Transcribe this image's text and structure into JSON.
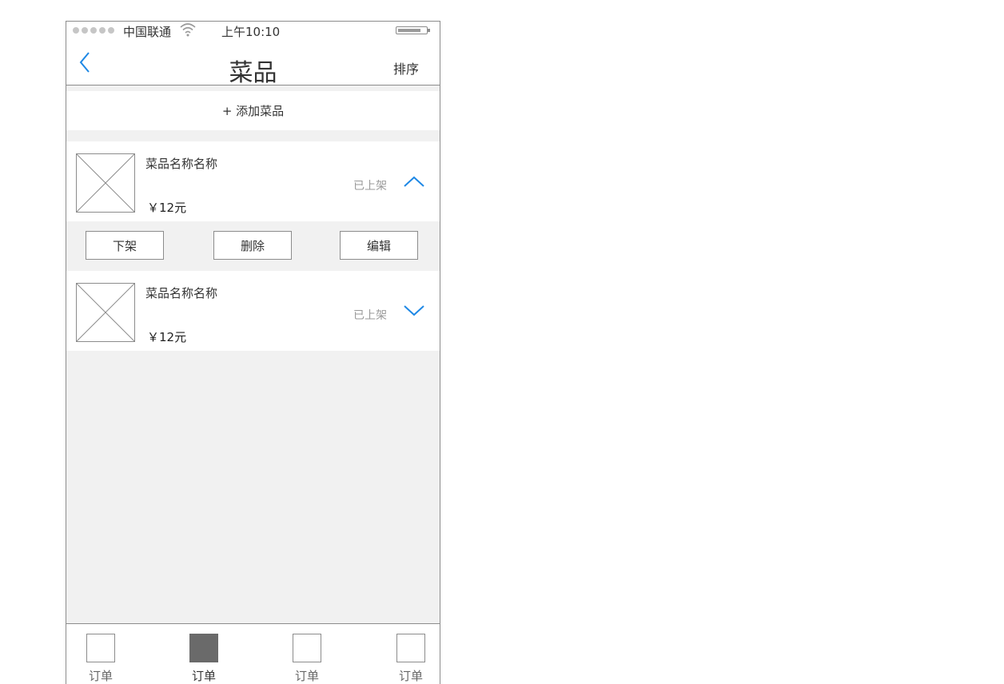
{
  "status_bar": {
    "carrier": "中国联通",
    "time": "上午10:10"
  },
  "nav": {
    "title": "菜品",
    "sort_label": "排序"
  },
  "add_dish_label": "+ 添加菜品",
  "dishes": [
    {
      "name": "菜品名称名称",
      "price": "￥12元",
      "status": "已上架",
      "expanded": true
    },
    {
      "name": "菜品名称名称",
      "price": "￥12元",
      "status": "已上架",
      "expanded": false
    }
  ],
  "actions": {
    "unlist": "下架",
    "delete": "删除",
    "edit": "编辑"
  },
  "tabs": [
    {
      "label": "订单",
      "active": false
    },
    {
      "label": "订单",
      "active": true
    },
    {
      "label": "订单",
      "active": false
    },
    {
      "label": "订单",
      "active": false
    }
  ],
  "colors": {
    "accent": "#1e88e5",
    "muted_text": "#999999",
    "active_tab": "#6a6a6a",
    "background": "#f1f1f1"
  }
}
